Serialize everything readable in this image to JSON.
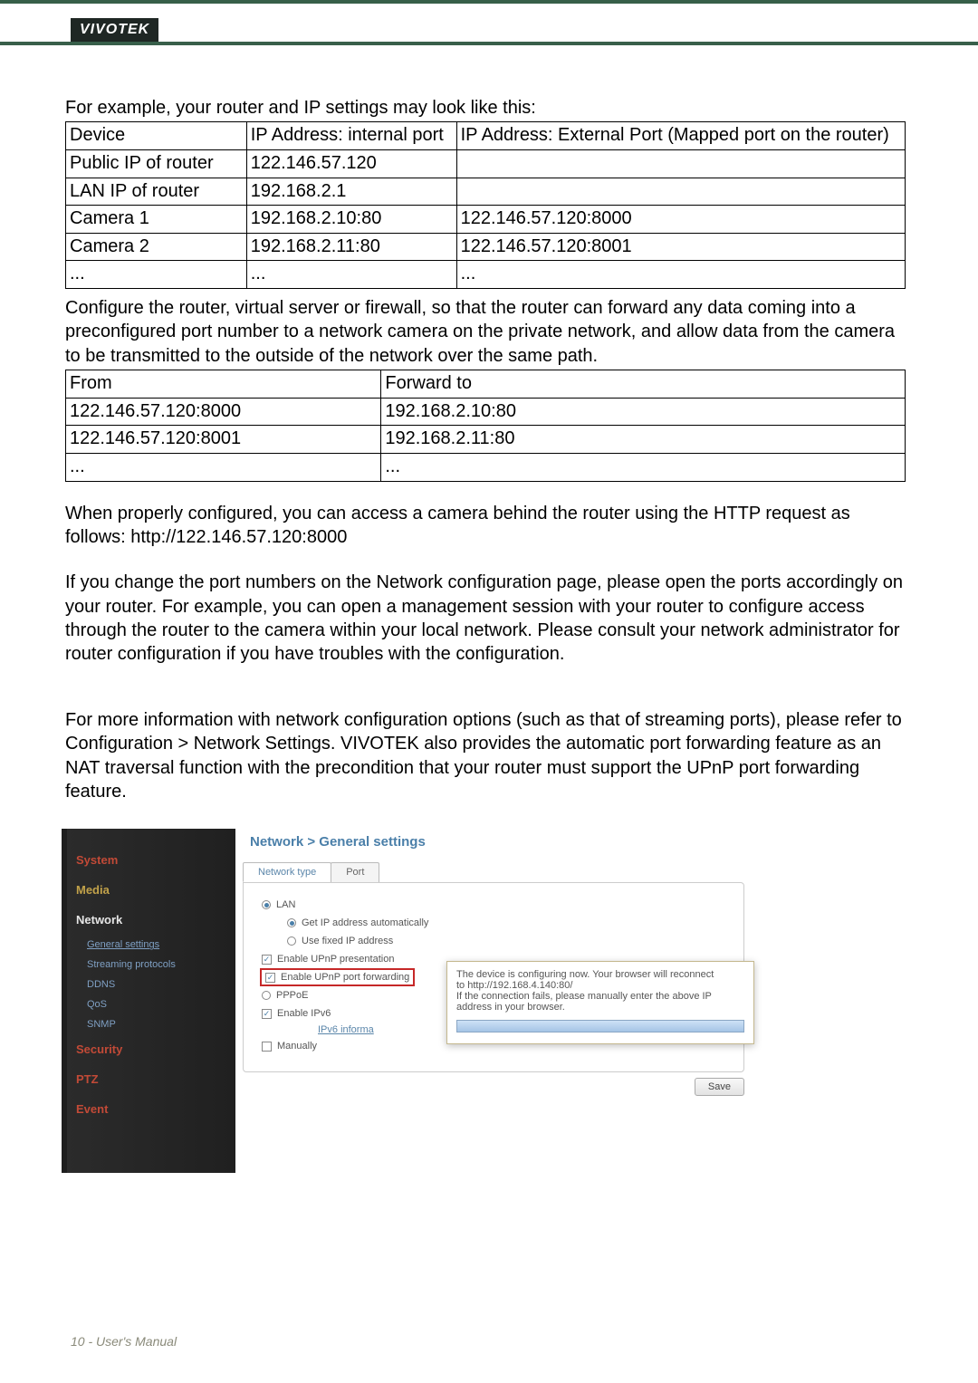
{
  "brand": "VIVOTEK",
  "footer": "10 - User's Manual",
  "lead": "For example, your router and IP settings may look like this:",
  "table1": {
    "header": [
      "Device",
      "IP Address: internal port",
      "IP Address: External Port (Mapped port on the router)"
    ],
    "rows": [
      [
        "Public IP of router",
        "122.146.57.120",
        ""
      ],
      [
        "LAN IP of router",
        "192.168.2.1",
        ""
      ],
      [
        "Camera 1",
        "192.168.2.10:80",
        "122.146.57.120:8000"
      ],
      [
        "Camera 2",
        "192.168.2.11:80",
        "122.146.57.120:8001"
      ],
      [
        "...",
        "...",
        "..."
      ]
    ]
  },
  "para1": "Configure the router, virtual server or firewall, so that the router can forward any data coming into a preconfigured port number to a network camera on the private network, and allow data from the camera to be transmitted to the outside of the network over the same path.",
  "table2": {
    "header": [
      "From",
      "Forward to"
    ],
    "rows": [
      [
        "122.146.57.120:8000",
        "192.168.2.10:80"
      ],
      [
        "122.146.57.120:8001",
        "192.168.2.11:80"
      ],
      [
        "...",
        "..."
      ]
    ]
  },
  "para2": "When properly configured, you can access a camera behind the router using the HTTP request as follows: http://122.146.57.120:8000",
  "para3": "If you change the port numbers on the Network configuration page, please open the ports accordingly on your router. For example, you can open a management session with your router to configure access through the router to the camera within your local network. Please consult your network administrator for router configuration if you have troubles with the configuration.",
  "para4": "For more information with network configuration options (such as that of streaming ports), please refer to Configuration > Network Settings. VIVOTEK also provides the automatic port forwarding feature as an NAT traversal function with the precondition that your router must support the UPnP port forwarding feature.",
  "ui": {
    "breadcrumb": "Network  >  General settings",
    "sidebar": {
      "items": [
        "System",
        "Media",
        "Network",
        "Security",
        "PTZ",
        "Event"
      ],
      "subitems": [
        "General settings",
        "Streaming protocols",
        "DDNS",
        "QoS",
        "SNMP"
      ]
    },
    "tabs": [
      "Network type",
      "Port"
    ],
    "opts": {
      "lan": "LAN",
      "auto": "Get IP address automatically",
      "fixed": "Use fixed IP address",
      "upnp_pres": "Enable UPnP presentation",
      "upnp_fwd": "Enable UPnP port forwarding",
      "pppoe": "PPPoE",
      "ipv6": "Enable IPv6",
      "ipv6_link": "IPv6 informa",
      "manual": "Manually"
    },
    "popup": {
      "l1": "The device is configuring now. Your browser will reconnect",
      "l2": "to http://192.168.4.140:80/",
      "l3": "If the connection fails, please manually enter the above IP",
      "l4": "address in your browser."
    },
    "save": "Save"
  }
}
